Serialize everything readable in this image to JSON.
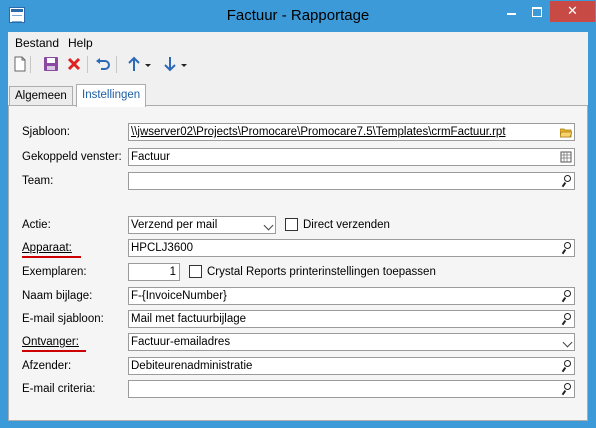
{
  "window": {
    "title": "Factuur - Rapportage"
  },
  "menu": {
    "bestand": "Bestand",
    "help": "Help"
  },
  "toolbar": {
    "new": "new-document-icon",
    "save": "save-icon",
    "delete": "delete-icon",
    "undo": "undo-icon",
    "up": "arrow-up-icon",
    "down": "arrow-down-icon"
  },
  "tabs": [
    {
      "label": "Algemeen"
    },
    {
      "label": "Instellingen"
    }
  ],
  "form": {
    "sjabloon": {
      "label": "Sjabloon:",
      "value": "\\\\jwserver02\\Projects\\Promocare\\Promocare7.5\\Templates\\crmFactuur.rpt"
    },
    "gekoppeld": {
      "label": "Gekoppeld venster:",
      "value": "Factuur"
    },
    "team": {
      "label": "Team:",
      "value": ""
    },
    "actie": {
      "label": "Actie:",
      "value": "Verzend per mail",
      "checkbox_label": "Direct verzenden",
      "checked": false
    },
    "apparaat": {
      "label": "Apparaat:",
      "value": "HPCLJ3600"
    },
    "exemplaren": {
      "label": "Exemplaren:",
      "value": "1",
      "checkbox_label": "Crystal Reports printerinstellingen toepassen",
      "checked": false
    },
    "naam_bijlage": {
      "label": "Naam bijlage:",
      "value": "F-{InvoiceNumber}"
    },
    "email_sjabloon": {
      "label": "E-mail sjabloon:",
      "value": "Mail met factuurbijlage"
    },
    "ontvanger": {
      "label": "Ontvanger:",
      "value": "Factuur-emailadres"
    },
    "afzender": {
      "label": "Afzender:",
      "value": "Debiteurenadministratie"
    },
    "email_criteria": {
      "label": "E-mail criteria:",
      "value": ""
    }
  },
  "colors": {
    "titlebar": "#3d9ad9",
    "required_underline": "#cc0000",
    "close_button": "#c74a45"
  }
}
